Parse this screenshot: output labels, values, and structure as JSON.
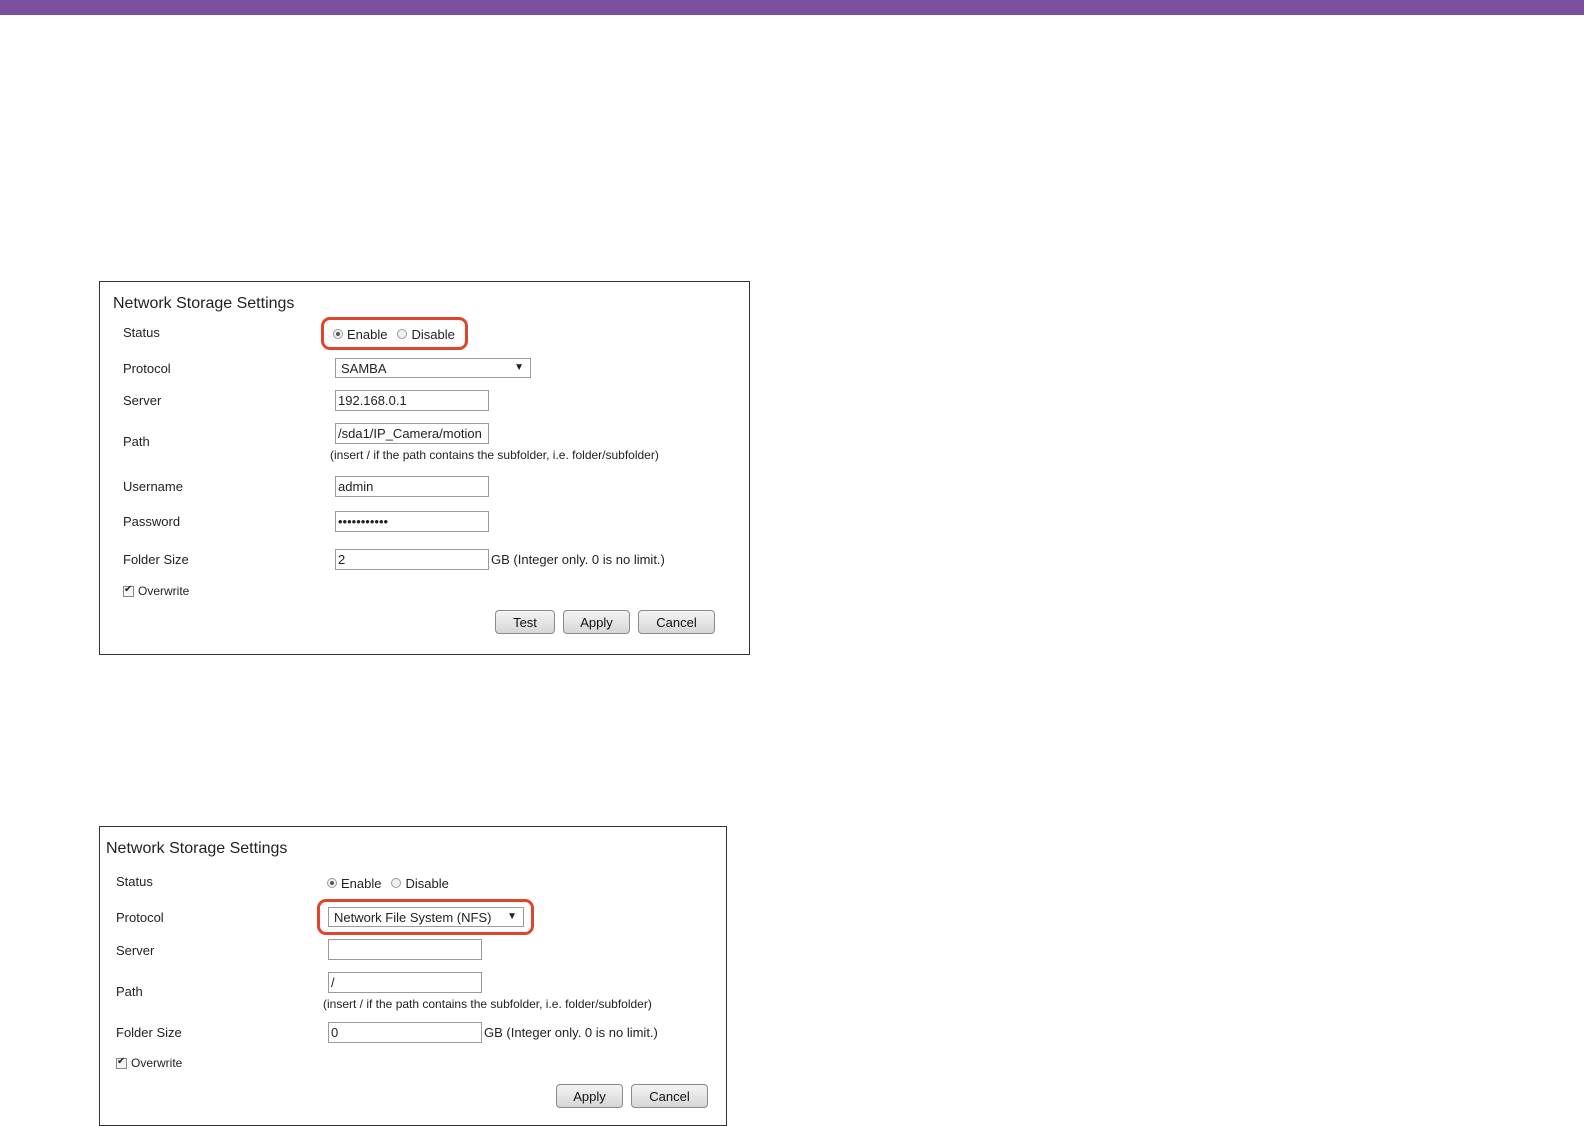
{
  "colors": {
    "top_bar": "#7a51a1",
    "highlight": "#e0452a"
  },
  "panel1": {
    "title": "Network Storage Settings",
    "status_label": "Status",
    "enable_label": "Enable",
    "disable_label": "Disable",
    "status_value": "Enable",
    "protocol_label": "Protocol",
    "protocol_value": "SAMBA",
    "server_label": "Server",
    "server_value": "192.168.0.1",
    "path_label": "Path",
    "path_value": "/sda1/IP_Camera/motion",
    "path_hint": "(insert / if the path contains the subfolder, i.e. folder/subfolder)",
    "username_label": "Username",
    "username_value": "admin",
    "password_label": "Password",
    "password_value": "•••••••••••",
    "folder_size_label": "Folder Size",
    "folder_size_value": "2",
    "folder_size_hint": "GB (Integer only. 0 is no limit.)",
    "overwrite_label": "Overwrite",
    "overwrite_checked": true,
    "test_label": "Test",
    "apply_label": "Apply",
    "cancel_label": "Cancel"
  },
  "panel2": {
    "title": "Network Storage Settings",
    "status_label": "Status",
    "enable_label": "Enable",
    "disable_label": "Disable",
    "status_value": "Enable",
    "protocol_label": "Protocol",
    "protocol_value": "Network File System (NFS)",
    "server_label": "Server",
    "server_value": "",
    "path_label": "Path",
    "path_value": "/",
    "path_hint": "(insert / if the path contains the subfolder, i.e. folder/subfolder)",
    "folder_size_label": "Folder Size",
    "folder_size_value": "0",
    "folder_size_hint": "GB (Integer only. 0 is no limit.)",
    "overwrite_label": "Overwrite",
    "overwrite_checked": true,
    "apply_label": "Apply",
    "cancel_label": "Cancel"
  }
}
